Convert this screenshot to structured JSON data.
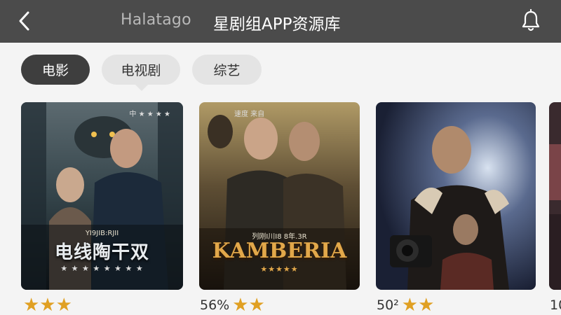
{
  "header": {
    "back_icon": "chevron-left-icon",
    "brand": "Halatago",
    "title": "星剧组APP资源库",
    "bell_icon": "bell-icon",
    "bg_color": "#4b4b4b"
  },
  "categories": {
    "items": [
      {
        "label": "电影",
        "active": true
      },
      {
        "label": "电视剧",
        "active": false
      },
      {
        "label": "综艺",
        "active": false
      }
    ],
    "active_color": "#3e3e3e",
    "inactive_color": "#e4e4e4"
  },
  "posters": [
    {
      "top_text": "中 ★ ★ ★ ★",
      "subtitle": "YI9JIB:RJII",
      "title": "电线陶干双",
      "stars_text": "★ ★ ★ ★ ★ ★ ★ ★"
    },
    {
      "top_text": "速度 来自",
      "subtitle": "列刚I川I8 8年.3R",
      "title": "KAMBERIA",
      "stars_text": "★★★★★"
    },
    {},
    {}
  ],
  "ratings": [
    {
      "text": "",
      "stars": "★★★"
    },
    {
      "text": "56%",
      "stars": "★★"
    },
    {
      "text": "50²",
      "stars": "★★"
    },
    {
      "text": "10",
      "stars": ""
    }
  ],
  "star_color": "#e0a023"
}
